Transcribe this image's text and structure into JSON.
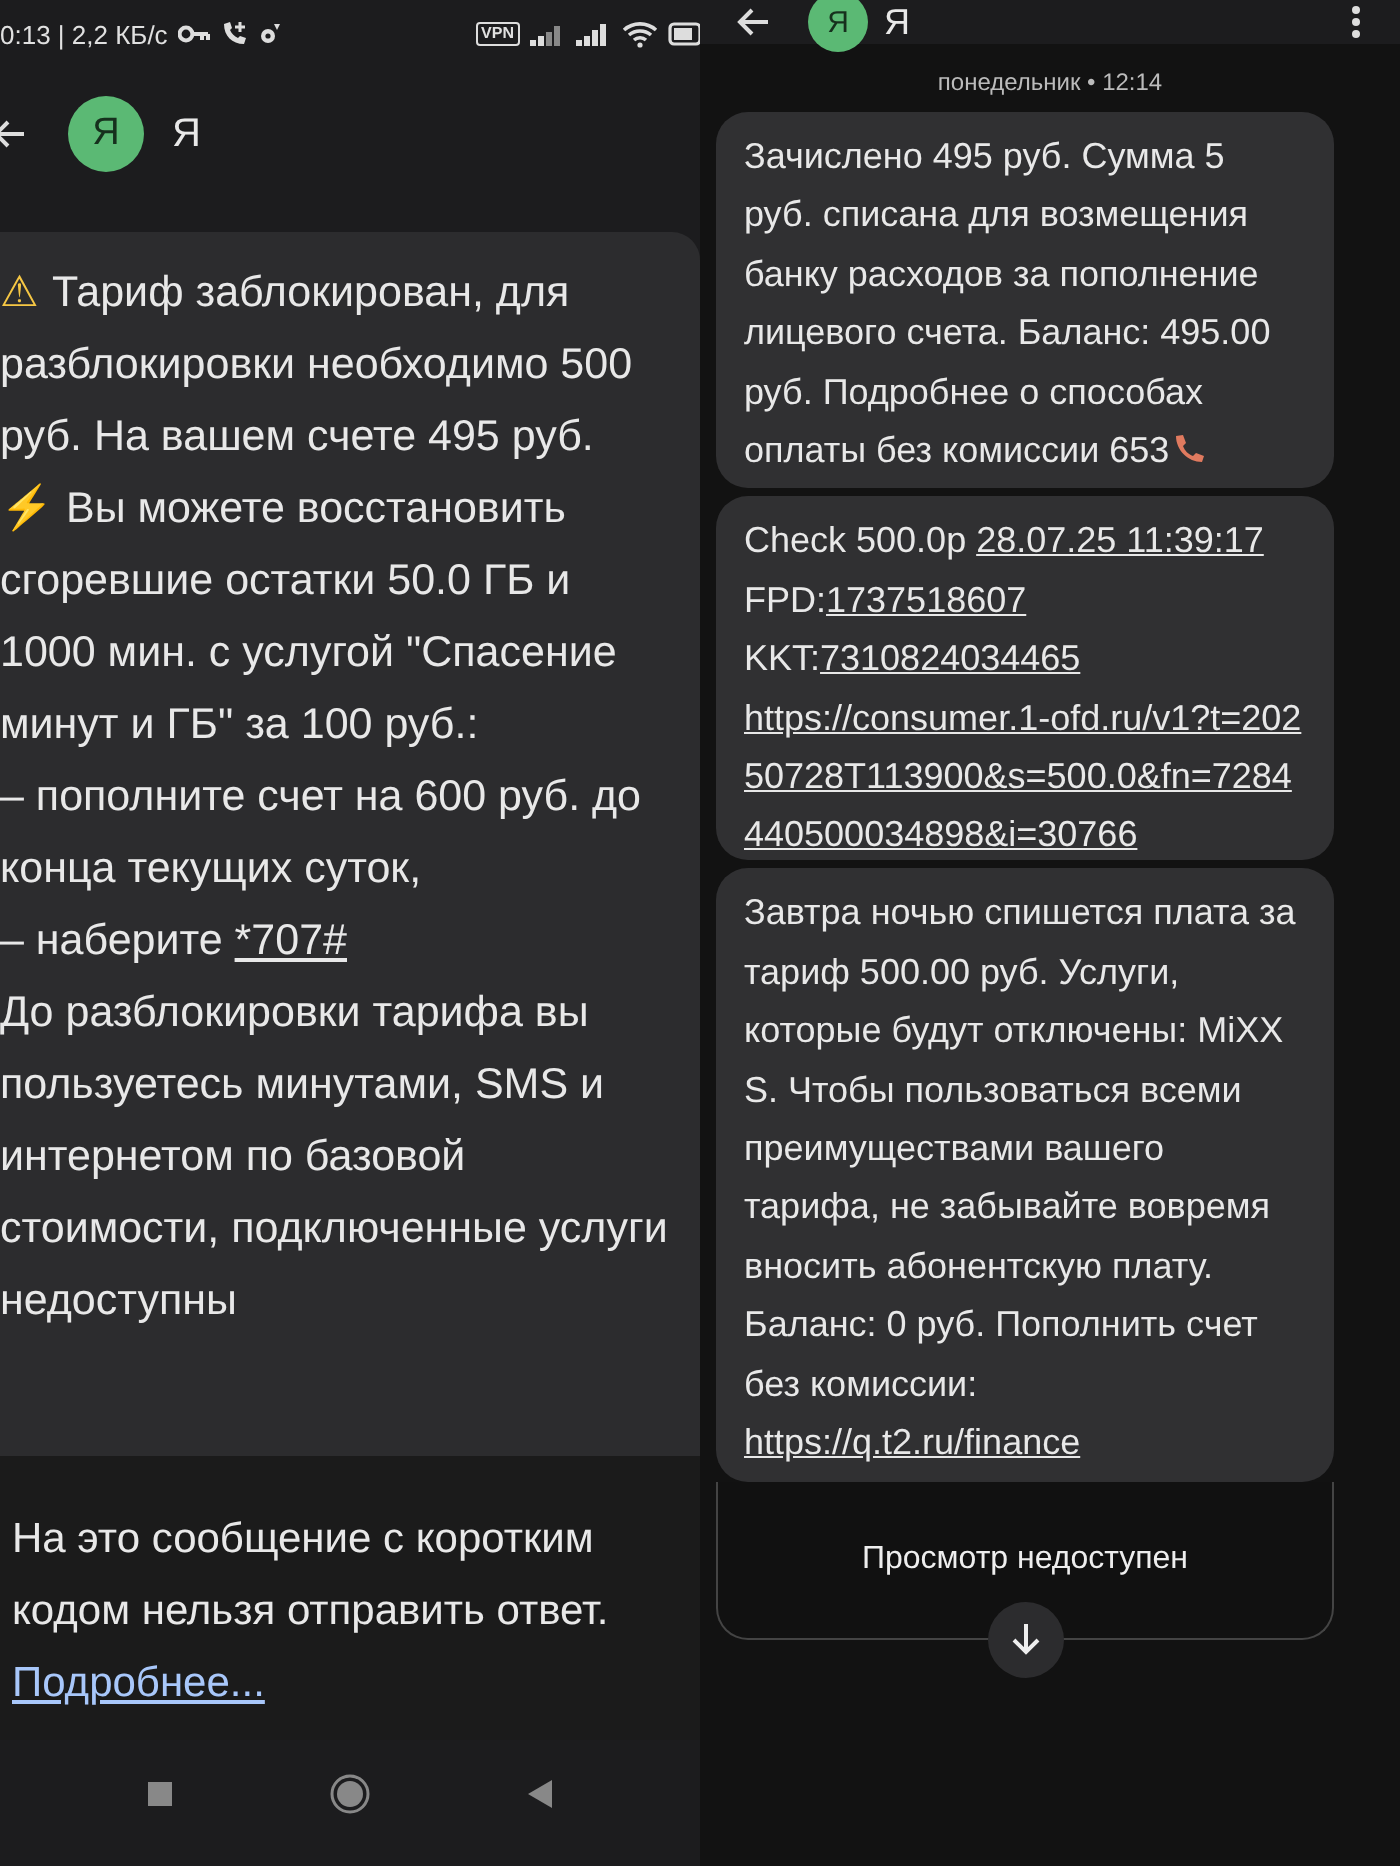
{
  "left_screen": {
    "status_bar": {
      "time_speed": "0:13 | 2,2 КБ/с",
      "vpn": "VPN"
    },
    "header": {
      "avatar": "Я",
      "title": "Я"
    },
    "message": [
      {
        "kind": "emoji",
        "text": "⚠"
      },
      {
        "kind": "plain",
        "text": " Тариф заблокирован, для разблокировки необходимо 500 руб. На вашем счете 495 руб.\n"
      },
      {
        "kind": "emoji",
        "text": "⚡"
      },
      {
        "kind": "plain",
        "text": " Вы можете восстановить сгоревшие остатки 50.0 ГБ и 1000 мин. с услугой \"Спасение минут и ГБ\" за 100 руб.:\n– пополните счет на 600 руб. до конца текущих суток,\n– наберите "
      },
      {
        "kind": "link",
        "text": "*707#"
      },
      {
        "kind": "plain",
        "text": "\nДо разблокировки тарифа вы пользуетесь минутами, SMS и интернетом по базовой стоимости, подключенные услуги недоступны"
      }
    ],
    "notice": {
      "text": "На это сообщение с коротким кодом нельзя отправить ответ.",
      "link": "Подробнее..."
    }
  },
  "right_screen": {
    "header": {
      "avatar": "Я",
      "title": "Я"
    },
    "date": "понедельник • 12:14",
    "messages": [
      {
        "parts": [
          {
            "kind": "plain",
            "text": "Зачислено 495 руб. Сумма 5 руб. списана для возмещения банку расходов за пополнение лицевого счета. Баланс: 495.00 руб. Подробнее о способах оплаты без комиссии 653"
          },
          {
            "kind": "phone"
          }
        ]
      },
      {
        "parts": [
          {
            "kind": "plain",
            "text": "Check 500.0р "
          },
          {
            "kind": "link",
            "text": "28.07.25 11:39:17"
          },
          {
            "kind": "plain",
            "text": "\nFPD:"
          },
          {
            "kind": "link",
            "text": "1737518607"
          },
          {
            "kind": "plain",
            "text": "\nKKT:"
          },
          {
            "kind": "link",
            "text": "7310824034465"
          },
          {
            "kind": "url",
            "text": "https://consumer.1-ofd.ru/v1?t=20250728T113900&s=500.0&fn=7284440500034898&i=30766"
          }
        ]
      },
      {
        "parts": [
          {
            "kind": "plain",
            "text": "Завтра ночью спишется плата за тариф 500.00 руб. Услуги, которые будут отключены: MiXX S. Чтобы пользоваться всеми преимуществами вашего тарифа, не забывайте вовремя вносить абонентскую плату. Баланс: 0 руб. Пополнить счет без комиссии:\n"
          },
          {
            "kind": "link",
            "text": "https://q.t2.ru/finance"
          }
        ]
      }
    ],
    "preview": "Просмотр недоступен"
  }
}
